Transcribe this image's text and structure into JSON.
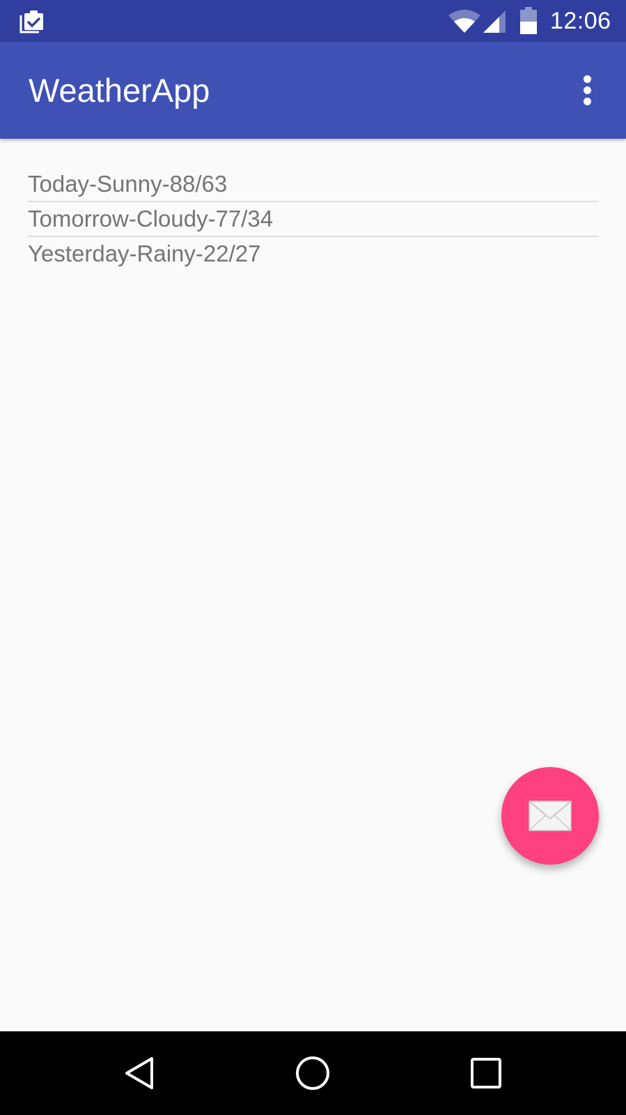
{
  "status_bar": {
    "time": "12:06",
    "icons": [
      "clipboard-check-icon",
      "wifi-icon",
      "cell-signal-icon",
      "battery-icon"
    ]
  },
  "app_bar": {
    "title": "WeatherApp",
    "menu_icon": "overflow-menu-icon"
  },
  "forecast_list": {
    "items": [
      "Today-Sunny-88/63",
      "Tomorrow-Cloudy-77/34",
      "Yesterday-Rainy-22/27"
    ]
  },
  "fab": {
    "icon": "mail-icon"
  },
  "nav_bar": {
    "icons": [
      "back-icon",
      "home-icon",
      "recents-icon"
    ]
  },
  "colors": {
    "status_bar": "#303f9f",
    "app_bar": "#3f51b5",
    "accent": "#ff4081",
    "background": "#fafafa",
    "list_text": "#757575",
    "divider": "#dedede"
  }
}
